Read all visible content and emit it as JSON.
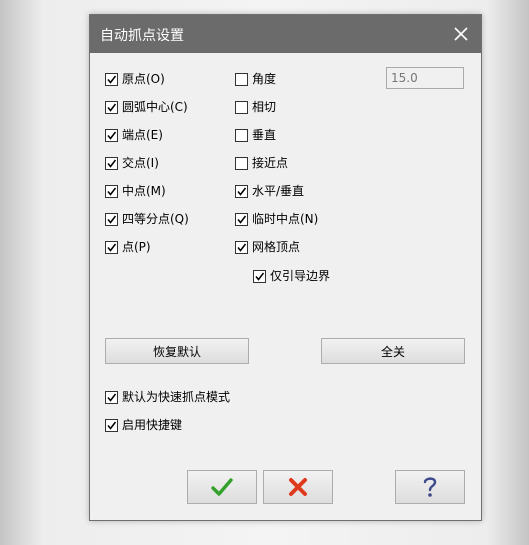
{
  "dialog": {
    "title": "自动抓点设置",
    "close_icon": "close-icon"
  },
  "left_options": [
    {
      "label": "原点(O)",
      "checked": true
    },
    {
      "label": "圆弧中心(C)",
      "checked": true
    },
    {
      "label": "端点(E)",
      "checked": true
    },
    {
      "label": "交点(I)",
      "checked": true
    },
    {
      "label": "中点(M)",
      "checked": true
    },
    {
      "label": "四等分点(Q)",
      "checked": true
    },
    {
      "label": "点(P)",
      "checked": true
    }
  ],
  "right_options": [
    {
      "label": "角度",
      "checked": false
    },
    {
      "label": "相切",
      "checked": false
    },
    {
      "label": "垂直",
      "checked": false
    },
    {
      "label": "接近点",
      "checked": false
    },
    {
      "label": "水平/垂直",
      "checked": true
    },
    {
      "label": "临时中点(N)",
      "checked": true
    },
    {
      "label": "网格顶点",
      "checked": true
    }
  ],
  "sub_option": {
    "label": "仅引导边界",
    "checked": true
  },
  "angle_value": "15.0",
  "buttons": {
    "restore_default": "恢复默认",
    "select_all": "全关"
  },
  "bottom_options": [
    {
      "label": "默认为快速抓点模式",
      "checked": true
    },
    {
      "label": "启用快捷键",
      "checked": true
    }
  ],
  "footer": {
    "ok_icon": "checkmark-icon",
    "cancel_icon": "x-icon",
    "help_icon": "question-icon"
  },
  "colors": {
    "titlebar": "#6b6b6b",
    "ok_green": "#33a02c",
    "cancel_red": "#e03a1e",
    "help_blue": "#3d4a8a"
  }
}
